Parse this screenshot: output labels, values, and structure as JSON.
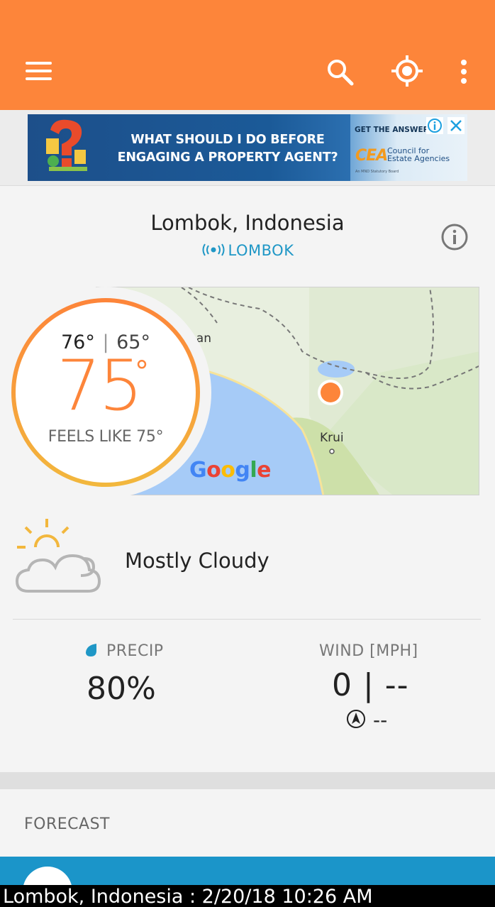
{
  "topbar": {
    "background": "#fd853a",
    "icons": [
      "hamburger-icon",
      "search-icon",
      "my-location-icon",
      "more-vert-icon"
    ]
  },
  "ad": {
    "headline_line1": "WHAT SHOULD I DO BEFORE",
    "headline_line2": "ENGAGING A PROPERTY AGENT?",
    "cta": "GET THE ANSWER",
    "brand_logo": "CEA",
    "brand_line1": "Council for",
    "brand_line2": "Estate Agencies",
    "brand_small": "An MND Statutory Board"
  },
  "location": {
    "title": "Lombok, Indonesia",
    "station": "LOMBOK"
  },
  "map": {
    "labels": {
      "place1": "han",
      "place2": "Krui"
    },
    "provider": {
      "g1": "G",
      "o1": "o",
      "o2": "o",
      "g2": "g",
      "l": "l",
      "e": "e"
    }
  },
  "temperature": {
    "high": "76°",
    "low": "65°",
    "current": "75",
    "degree": "°",
    "feels_like": "FEELS LIKE 75°"
  },
  "conditions": {
    "text": "Mostly Cloudy",
    "icon": "partly-cloudy-day-icon"
  },
  "precip": {
    "label": "PRECIP",
    "value": "80%"
  },
  "wind": {
    "label": "WIND [MPH]",
    "value": "0 | --",
    "direction": "--"
  },
  "forecast": {
    "label": "FORECAST"
  },
  "caption": "Lombok, Indonesia : 2/20/18 10:26 AM",
  "colors": {
    "accent": "#fd853a",
    "station": "#1f97c6",
    "forecast_card": "#1b95c9",
    "ring_start": "#fd853a",
    "ring_end": "#f2b73d"
  }
}
